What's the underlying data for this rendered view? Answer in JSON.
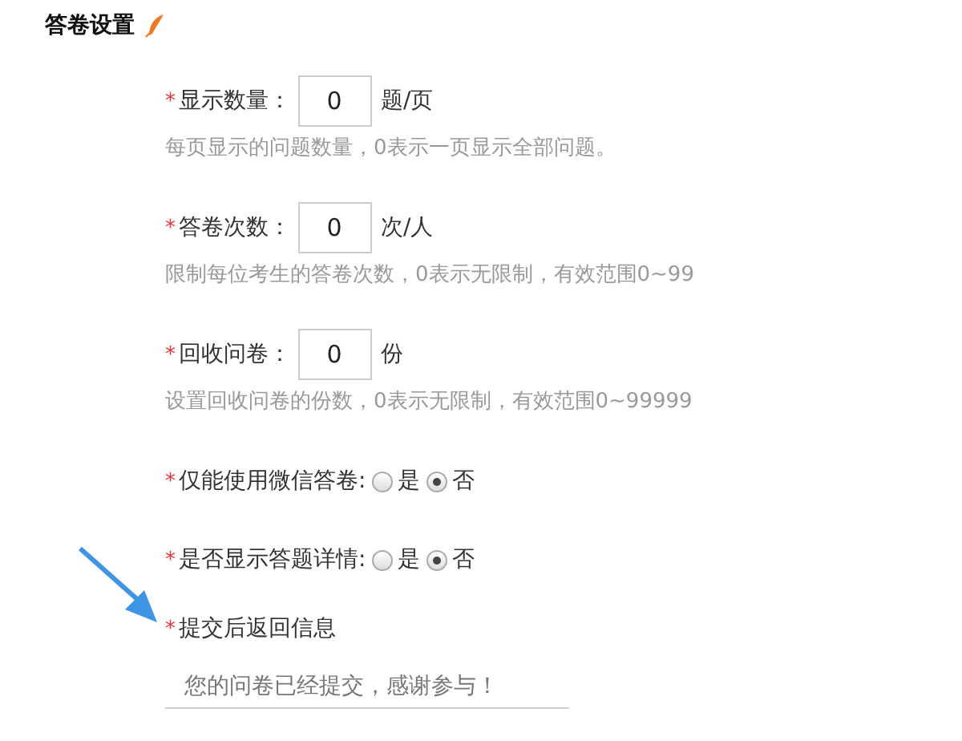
{
  "section": {
    "title": "答卷设置"
  },
  "fields": [
    {
      "kind": "number",
      "required": true,
      "marker": "*",
      "label": "显示数量：",
      "value": "0",
      "unit": "题/页",
      "hint": "每页显示的问题数量，0表示一页显示全部问题。"
    },
    {
      "kind": "number",
      "required": true,
      "marker": "*",
      "label": "答卷次数：",
      "value": "0",
      "unit": "次/人",
      "hint": "限制每位考生的答卷次数，0表示无限制，有效范围0~99"
    },
    {
      "kind": "number",
      "required": true,
      "marker": "*",
      "label": "回收问卷：",
      "value": "0",
      "unit": "份",
      "hint": "设置回收问卷的份数，0表示无限制，有效范围0~99999"
    },
    {
      "kind": "radio",
      "required": true,
      "marker": "*",
      "label": "仅能使用微信答卷:",
      "options": [
        {
          "label": "是",
          "selected": false
        },
        {
          "label": "否",
          "selected": true
        }
      ]
    },
    {
      "kind": "radio",
      "required": true,
      "marker": "*",
      "label": "是否显示答题详情:",
      "options": [
        {
          "label": "是",
          "selected": false
        },
        {
          "label": "否",
          "selected": true
        }
      ]
    },
    {
      "kind": "text",
      "required": true,
      "marker": "*",
      "label": "提交后返回信息",
      "placeholder": "您的问卷已经提交，感谢参与！"
    }
  ]
}
